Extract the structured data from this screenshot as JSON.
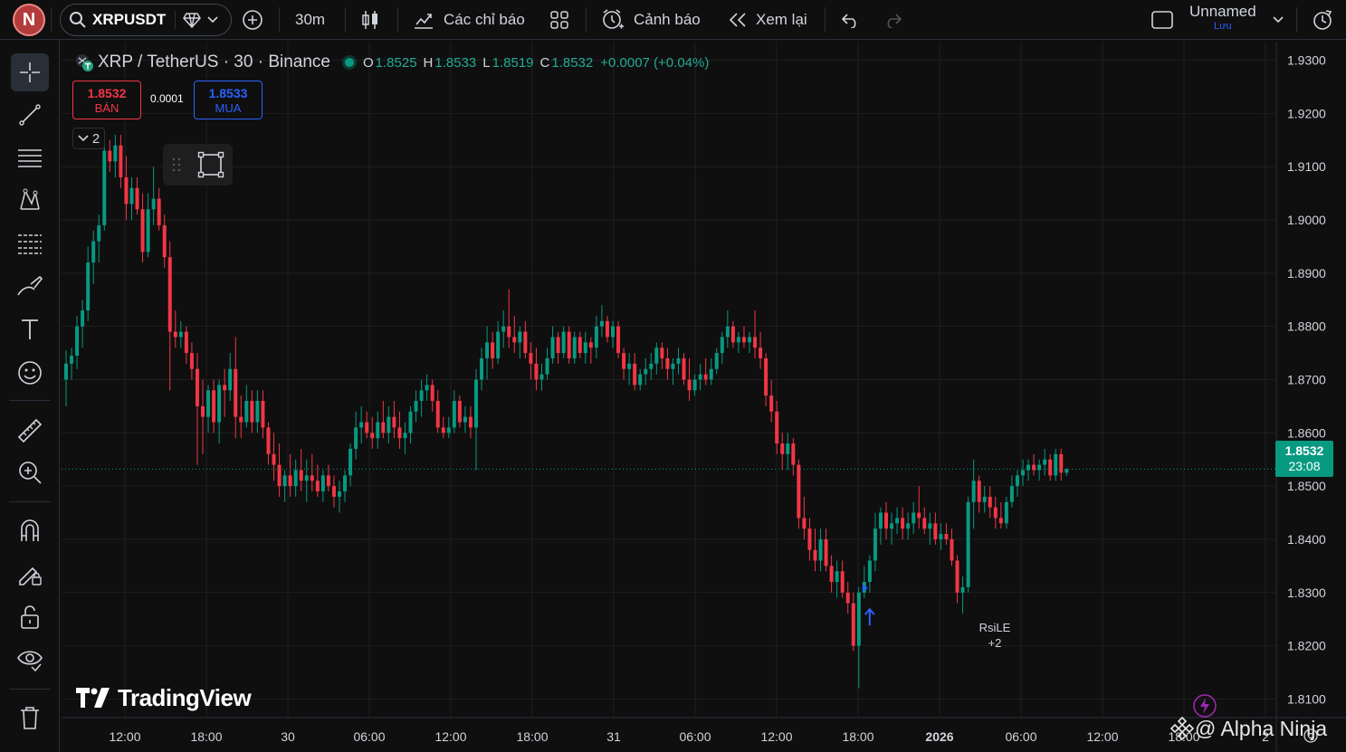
{
  "topbar": {
    "avatar_letter": "N",
    "symbol": "XRPUSDT",
    "interval": "30m",
    "indicators_label": "Các chỉ báo",
    "alerts_label": "Cảnh báo",
    "replay_label": "Xem lại",
    "layout_name": "Unnamed",
    "layout_save": "Lưu"
  },
  "legend": {
    "title": "XRP / TetherUS · 30 · Binance",
    "o_key": "O",
    "o": "1.8525",
    "h_key": "H",
    "h": "1.8533",
    "l_key": "L",
    "l": "1.8519",
    "c_key": "C",
    "c": "1.8532",
    "change": "+0.0007 (+0.04%)"
  },
  "trade": {
    "sell_price": "1.8532",
    "sell_label": "BÁN",
    "buy_price": "1.8533",
    "buy_label": "MUA",
    "spread": "0.0001"
  },
  "indicators_count": "2",
  "last_price": {
    "value": "1.8532",
    "countdown": "23:08"
  },
  "signal": {
    "name": "RsiLE",
    "extra": "+2"
  },
  "brand": "TradingView",
  "watermark": "@ Alpha Ninja",
  "colors": {
    "up": "#089981",
    "down": "#f23645",
    "buy": "#2962ff",
    "bg": "#0f0f0f",
    "grid": "#1f1f1f",
    "text": "#d1d4dc"
  },
  "chart_data": {
    "type": "candlestick",
    "title": "XRP / TetherUS · 30 · Binance",
    "ylim": [
      1.8065,
      1.9335
    ],
    "y_ticks": [
      "1.9300",
      "1.9200",
      "1.9100",
      "1.9000",
      "1.8900",
      "1.8800",
      "1.8700",
      "1.8600",
      "1.8500",
      "1.8400",
      "1.8300",
      "1.8200",
      "1.8100"
    ],
    "x_ticks": [
      "12:00",
      "18:00",
      "30",
      "06:00",
      "12:00",
      "18:00",
      "31",
      "06:00",
      "12:00",
      "18:00",
      "2026",
      "06:00",
      "12:00",
      "18:00",
      "2"
    ],
    "x_tick_bold": [
      false,
      false,
      false,
      false,
      false,
      false,
      false,
      false,
      false,
      false,
      true,
      false,
      false,
      false,
      false
    ],
    "grid": true,
    "last_close": 1.8532,
    "candles": [
      [
        1.87,
        1.8755,
        1.865,
        1.873
      ],
      [
        1.873,
        1.876,
        1.87,
        1.8745
      ],
      [
        1.8745,
        1.882,
        1.872,
        1.88
      ],
      [
        1.88,
        1.885,
        1.876,
        1.883
      ],
      [
        1.883,
        1.895,
        1.881,
        1.892
      ],
      [
        1.892,
        1.898,
        1.888,
        1.896
      ],
      [
        1.896,
        1.901,
        1.892,
        1.899
      ],
      [
        1.899,
        1.917,
        1.898,
        1.913
      ],
      [
        1.913,
        1.915,
        1.909,
        1.911
      ],
      [
        1.911,
        1.916,
        1.908,
        1.914
      ],
      [
        1.914,
        1.916,
        1.906,
        1.908
      ],
      [
        1.908,
        1.912,
        1.9,
        1.903
      ],
      [
        1.903,
        1.908,
        1.9,
        1.906
      ],
      [
        1.906,
        1.908,
        1.901,
        1.902
      ],
      [
        1.902,
        1.905,
        1.892,
        1.894
      ],
      [
        1.894,
        1.905,
        1.893,
        1.902
      ],
      [
        1.902,
        1.91,
        1.899,
        1.904
      ],
      [
        1.904,
        1.906,
        1.898,
        1.899
      ],
      [
        1.899,
        1.901,
        1.891,
        1.893
      ],
      [
        1.893,
        1.896,
        1.868,
        1.879
      ],
      [
        1.879,
        1.883,
        1.876,
        1.878
      ],
      [
        1.878,
        1.881,
        1.876,
        1.879
      ],
      [
        1.879,
        1.88,
        1.873,
        1.875
      ],
      [
        1.875,
        1.877,
        1.87,
        1.872
      ],
      [
        1.872,
        1.875,
        1.854,
        1.865
      ],
      [
        1.865,
        1.87,
        1.856,
        1.863
      ],
      [
        1.863,
        1.869,
        1.86,
        1.868
      ],
      [
        1.868,
        1.87,
        1.86,
        1.862
      ],
      [
        1.862,
        1.87,
        1.858,
        1.869
      ],
      [
        1.869,
        1.872,
        1.863,
        1.868
      ],
      [
        1.868,
        1.875,
        1.866,
        1.872
      ],
      [
        1.872,
        1.878,
        1.859,
        1.863
      ],
      [
        1.863,
        1.867,
        1.859,
        1.862
      ],
      [
        1.862,
        1.869,
        1.861,
        1.866
      ],
      [
        1.866,
        1.868,
        1.86,
        1.862
      ],
      [
        1.862,
        1.868,
        1.86,
        1.866
      ],
      [
        1.866,
        1.868,
        1.859,
        1.861
      ],
      [
        1.861,
        1.862,
        1.854,
        1.856
      ],
      [
        1.856,
        1.86,
        1.851,
        1.854
      ],
      [
        1.854,
        1.858,
        1.848,
        1.85
      ],
      [
        1.85,
        1.853,
        1.847,
        1.852
      ],
      [
        1.852,
        1.856,
        1.848,
        1.85
      ],
      [
        1.85,
        1.855,
        1.848,
        1.853
      ],
      [
        1.853,
        1.857,
        1.849,
        1.851
      ],
      [
        1.851,
        1.855,
        1.847,
        1.852
      ],
      [
        1.852,
        1.856,
        1.849,
        1.851
      ],
      [
        1.851,
        1.854,
        1.848,
        1.849
      ],
      [
        1.849,
        1.853,
        1.847,
        1.852
      ],
      [
        1.852,
        1.854,
        1.849,
        1.85
      ],
      [
        1.85,
        1.852,
        1.846,
        1.848
      ],
      [
        1.848,
        1.851,
        1.845,
        1.849
      ],
      [
        1.849,
        1.853,
        1.847,
        1.852
      ],
      [
        1.852,
        1.858,
        1.85,
        1.857
      ],
      [
        1.857,
        1.864,
        1.855,
        1.861
      ],
      [
        1.861,
        1.865,
        1.858,
        1.862
      ],
      [
        1.862,
        1.864,
        1.859,
        1.86
      ],
      [
        1.86,
        1.863,
        1.857,
        1.859
      ],
      [
        1.859,
        1.864,
        1.857,
        1.862
      ],
      [
        1.862,
        1.866,
        1.859,
        1.86
      ],
      [
        1.86,
        1.865,
        1.858,
        1.863
      ],
      [
        1.863,
        1.866,
        1.859,
        1.861
      ],
      [
        1.861,
        1.864,
        1.857,
        1.859
      ],
      [
        1.859,
        1.862,
        1.856,
        1.86
      ],
      [
        1.86,
        1.865,
        1.858,
        1.864
      ],
      [
        1.864,
        1.868,
        1.862,
        1.866
      ],
      [
        1.866,
        1.87,
        1.863,
        1.868
      ],
      [
        1.868,
        1.871,
        1.866,
        1.869
      ],
      [
        1.869,
        1.87,
        1.864,
        1.866
      ],
      [
        1.866,
        1.868,
        1.86,
        1.861
      ],
      [
        1.861,
        1.863,
        1.859,
        1.86
      ],
      [
        1.86,
        1.863,
        1.859,
        1.861
      ],
      [
        1.861,
        1.868,
        1.86,
        1.866
      ],
      [
        1.866,
        1.867,
        1.861,
        1.862
      ],
      [
        1.862,
        1.865,
        1.86,
        1.863
      ],
      [
        1.863,
        1.865,
        1.859,
        1.861
      ],
      [
        1.861,
        1.872,
        1.853,
        1.87
      ],
      [
        1.87,
        1.876,
        1.868,
        1.874
      ],
      [
        1.874,
        1.88,
        1.87,
        1.877
      ],
      [
        1.877,
        1.879,
        1.872,
        1.874
      ],
      [
        1.874,
        1.881,
        1.873,
        1.879
      ],
      [
        1.879,
        1.883,
        1.876,
        1.88
      ],
      [
        1.88,
        1.887,
        1.876,
        1.878
      ],
      [
        1.878,
        1.882,
        1.875,
        1.877
      ],
      [
        1.877,
        1.88,
        1.874,
        1.879
      ],
      [
        1.879,
        1.881,
        1.874,
        1.875
      ],
      [
        1.875,
        1.877,
        1.87,
        1.873
      ],
      [
        1.873,
        1.876,
        1.868,
        1.87
      ],
      [
        1.87,
        1.873,
        1.868,
        1.871
      ],
      [
        1.871,
        1.876,
        1.87,
        1.874
      ],
      [
        1.874,
        1.88,
        1.873,
        1.878
      ],
      [
        1.878,
        1.879,
        1.873,
        1.875
      ],
      [
        1.875,
        1.88,
        1.874,
        1.879
      ],
      [
        1.879,
        1.88,
        1.873,
        1.874
      ],
      [
        1.874,
        1.879,
        1.873,
        1.878
      ],
      [
        1.878,
        1.879,
        1.874,
        1.875
      ],
      [
        1.875,
        1.879,
        1.873,
        1.877
      ],
      [
        1.877,
        1.878,
        1.873,
        1.876
      ],
      [
        1.876,
        1.882,
        1.874,
        1.88
      ],
      [
        1.88,
        1.884,
        1.878,
        1.881
      ],
      [
        1.881,
        1.882,
        1.877,
        1.878
      ],
      [
        1.878,
        1.881,
        1.876,
        1.88
      ],
      [
        1.88,
        1.881,
        1.874,
        1.875
      ],
      [
        1.875,
        1.876,
        1.87,
        1.872
      ],
      [
        1.872,
        1.875,
        1.869,
        1.873
      ],
      [
        1.873,
        1.875,
        1.868,
        1.869
      ],
      [
        1.869,
        1.872,
        1.868,
        1.871
      ],
      [
        1.871,
        1.874,
        1.869,
        1.872
      ],
      [
        1.872,
        1.875,
        1.87,
        1.873
      ],
      [
        1.873,
        1.877,
        1.871,
        1.876
      ],
      [
        1.876,
        1.877,
        1.872,
        1.874
      ],
      [
        1.874,
        1.876,
        1.87,
        1.872
      ],
      [
        1.872,
        1.874,
        1.869,
        1.873
      ],
      [
        1.873,
        1.876,
        1.871,
        1.874
      ],
      [
        1.874,
        1.875,
        1.869,
        1.87
      ],
      [
        1.87,
        1.874,
        1.866,
        1.868
      ],
      [
        1.868,
        1.871,
        1.867,
        1.87
      ],
      [
        1.87,
        1.873,
        1.868,
        1.871
      ],
      [
        1.871,
        1.874,
        1.869,
        1.87
      ],
      [
        1.87,
        1.874,
        1.869,
        1.872
      ],
      [
        1.872,
        1.876,
        1.871,
        1.875
      ],
      [
        1.875,
        1.879,
        1.873,
        1.878
      ],
      [
        1.878,
        1.883,
        1.876,
        1.88
      ],
      [
        1.88,
        1.881,
        1.876,
        1.877
      ],
      [
        1.877,
        1.879,
        1.875,
        1.878
      ],
      [
        1.878,
        1.88,
        1.876,
        1.877
      ],
      [
        1.877,
        1.879,
        1.875,
        1.878
      ],
      [
        1.878,
        1.883,
        1.874,
        1.876
      ],
      [
        1.876,
        1.879,
        1.872,
        1.874
      ],
      [
        1.874,
        1.875,
        1.865,
        1.867
      ],
      [
        1.867,
        1.87,
        1.862,
        1.864
      ],
      [
        1.864,
        1.866,
        1.856,
        1.858
      ],
      [
        1.858,
        1.86,
        1.853,
        1.856
      ],
      [
        1.856,
        1.86,
        1.853,
        1.858
      ],
      [
        1.858,
        1.859,
        1.852,
        1.854
      ],
      [
        1.854,
        1.855,
        1.842,
        1.844
      ],
      [
        1.844,
        1.848,
        1.84,
        1.842
      ],
      [
        1.842,
        1.844,
        1.836,
        1.838
      ],
      [
        1.838,
        1.842,
        1.834,
        1.836
      ],
      [
        1.836,
        1.842,
        1.834,
        1.84
      ],
      [
        1.84,
        1.842,
        1.834,
        1.835
      ],
      [
        1.835,
        1.837,
        1.83,
        1.832
      ],
      [
        1.832,
        1.836,
        1.829,
        1.834
      ],
      [
        1.834,
        1.836,
        1.829,
        1.83
      ],
      [
        1.83,
        1.832,
        1.826,
        1.828
      ],
      [
        1.828,
        1.83,
        1.819,
        1.82
      ],
      [
        1.82,
        1.831,
        1.812,
        1.83
      ],
      [
        1.83,
        1.835,
        1.829,
        1.832
      ],
      [
        1.832,
        1.837,
        1.83,
        1.836
      ],
      [
        1.836,
        1.845,
        1.834,
        1.842
      ],
      [
        1.842,
        1.846,
        1.839,
        1.845
      ],
      [
        1.845,
        1.847,
        1.84,
        1.842
      ],
      [
        1.842,
        1.845,
        1.839,
        1.843
      ],
      [
        1.843,
        1.846,
        1.841,
        1.844
      ],
      [
        1.844,
        1.846,
        1.84,
        1.842
      ],
      [
        1.842,
        1.845,
        1.84,
        1.843
      ],
      [
        1.843,
        1.847,
        1.841,
        1.845
      ],
      [
        1.845,
        1.85,
        1.842,
        1.844
      ],
      [
        1.844,
        1.846,
        1.841,
        1.842
      ],
      [
        1.842,
        1.845,
        1.839,
        1.843
      ],
      [
        1.843,
        1.845,
        1.839,
        1.84
      ],
      [
        1.84,
        1.843,
        1.838,
        1.841
      ],
      [
        1.841,
        1.843,
        1.839,
        1.84
      ],
      [
        1.84,
        1.842,
        1.835,
        1.836
      ],
      [
        1.836,
        1.837,
        1.828,
        1.83
      ],
      [
        1.83,
        1.833,
        1.826,
        1.831
      ],
      [
        1.831,
        1.848,
        1.83,
        1.847
      ],
      [
        1.847,
        1.855,
        1.842,
        1.851
      ],
      [
        1.851,
        1.852,
        1.845,
        1.847
      ],
      [
        1.847,
        1.85,
        1.845,
        1.848
      ],
      [
        1.848,
        1.85,
        1.844,
        1.846
      ],
      [
        1.846,
        1.848,
        1.842,
        1.844
      ],
      [
        1.844,
        1.847,
        1.842,
        1.843
      ],
      [
        1.843,
        1.848,
        1.842,
        1.847
      ],
      [
        1.847,
        1.852,
        1.846,
        1.85
      ],
      [
        1.85,
        1.853,
        1.848,
        1.852
      ],
      [
        1.852,
        1.855,
        1.85,
        1.853
      ],
      [
        1.853,
        1.855,
        1.851,
        1.854
      ],
      [
        1.854,
        1.856,
        1.852,
        1.853
      ],
      [
        1.853,
        1.855,
        1.851,
        1.854
      ],
      [
        1.854,
        1.857,
        1.852,
        1.855
      ],
      [
        1.855,
        1.856,
        1.851,
        1.852
      ],
      [
        1.852,
        1.857,
        1.851,
        1.856
      ],
      [
        1.856,
        1.857,
        1.851,
        1.8525
      ],
      [
        1.8525,
        1.8533,
        1.8519,
        1.8532
      ]
    ]
  }
}
